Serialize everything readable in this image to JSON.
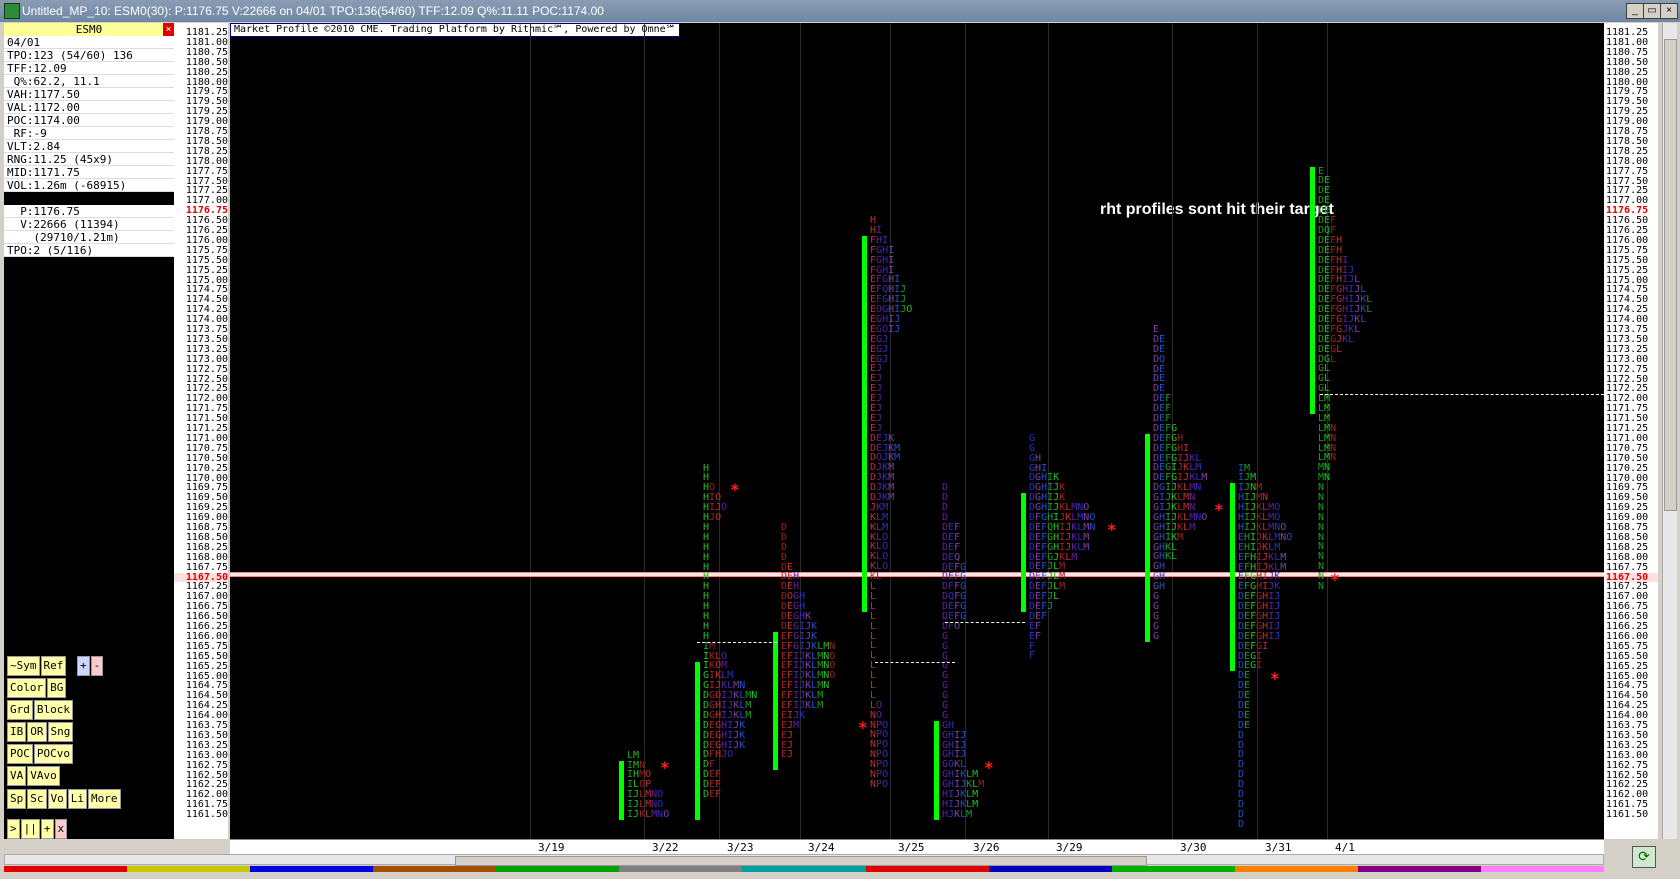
{
  "window": {
    "title": "Untitled_MP_10: ESM0(30): P:1176.75 V:22666 on 04/01 TPO:136(54/60) TFF:12.09 Q%:11.11 POC:1174.00",
    "controls": [
      "_",
      "▭",
      "×"
    ],
    "inner_controls": [
      "_",
      "▭",
      "×"
    ]
  },
  "panel": {
    "symbol": "ESM0",
    "close": "×",
    "info": [
      "04/01",
      "TPO:123 (54/60) 136",
      "TFF:12.09",
      " Q%:62.2, 11.1",
      "VAH:1177.50",
      "VAL:1172.00",
      "POC:1174.00",
      " RF:-9",
      "VLT:2.84",
      "RNG:11.25 (45x9)",
      "MID:1171.75",
      "VOL:1.26m (-68915)"
    ],
    "info2": [
      "  P:1176.75",
      "  V:22666 (11394)",
      "    (29710/1.21m)",
      "TPO:2 (5/116)"
    ]
  },
  "buttons": {
    "row1": [
      "~Sym",
      "Ref",
      "+",
      "-"
    ],
    "row2": [
      "Color",
      "BG"
    ],
    "row3": [
      "Grd",
      "Block"
    ],
    "row4": [
      "IB",
      "OR",
      "Sng"
    ],
    "row5": [
      "POC",
      "POCvo"
    ],
    "row6": [
      "VA",
      "VAvo"
    ],
    "row7": [
      "Sp",
      "Sc",
      "Vo",
      "Li",
      "More"
    ],
    "row8": [
      ">",
      "||",
      "+",
      "x"
    ]
  },
  "chart": {
    "copyright": "Market Profile ©2010 CME. Trading Platform by Rithmic℠, Powered by Omne℠",
    "annotation": "rht profiles sont hit their target",
    "current_price_label": "1167.50",
    "last_price_label": "1176.75",
    "price_max": 1181.25,
    "price_step": 0.25,
    "price_count": 80,
    "dates": [
      "3/19",
      "3/22",
      "3/23",
      "3/24",
      "3/25",
      "3/26",
      "3/29",
      "3/30",
      "3/31",
      "4/1"
    ],
    "session_colors": [
      "#e00000",
      "#c8c800",
      "#0000e0",
      "#a05000",
      "#00a000",
      "#808080",
      "#00a0a0",
      "#e00000",
      "#0000c0",
      "#00b000",
      "#ff8000",
      "#800080",
      "#ff80ff"
    ]
  }
}
